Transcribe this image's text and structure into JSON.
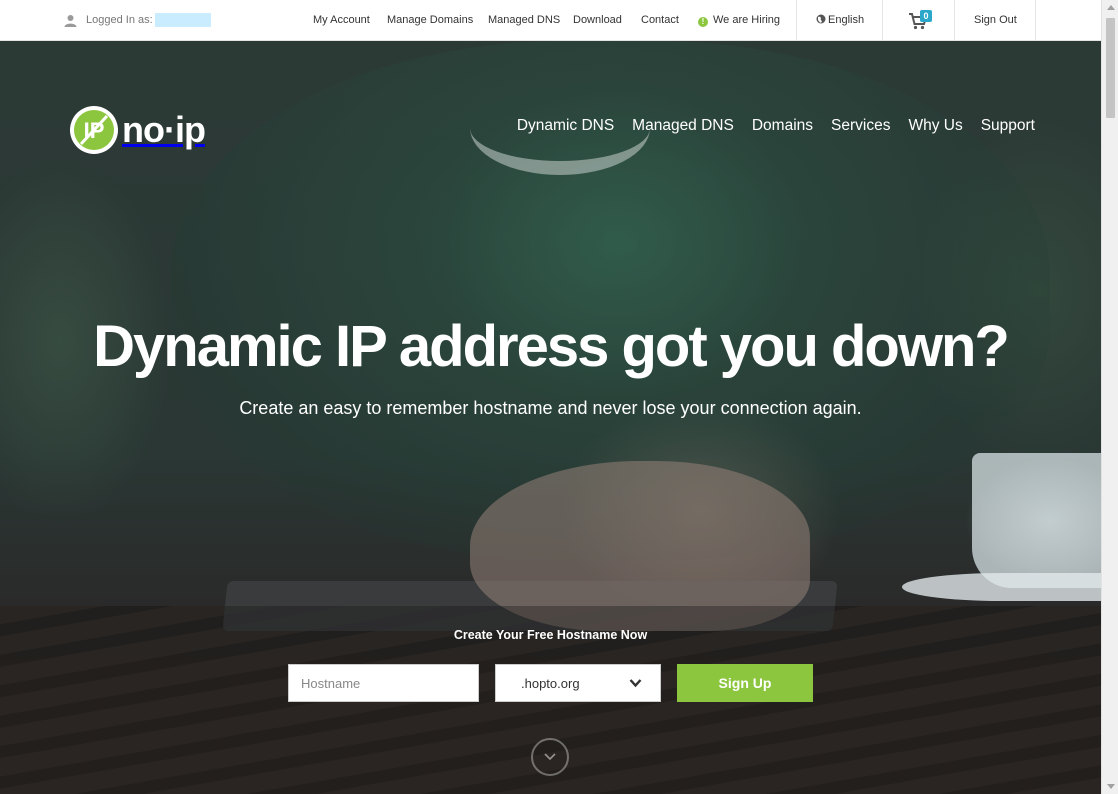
{
  "topbar": {
    "logged_in_label": "Logged In as:",
    "links": {
      "my_account": "My Account",
      "manage_domains": "Manage Domains",
      "managed_dns": "Managed DNS",
      "download": "Download",
      "contact": "Contact",
      "hiring": "We are Hiring",
      "language": "English",
      "sign_out": "Sign Out"
    },
    "cart_count": "0"
  },
  "brand": {
    "logo_text": "no·ip",
    "accent_color": "#8cc63f"
  },
  "main_nav": {
    "items": [
      "Dynamic DNS",
      "Managed DNS",
      "Domains",
      "Services",
      "Why Us",
      "Support"
    ]
  },
  "hero": {
    "headline": "Dynamic IP address got you down?",
    "subline": "Create an easy to remember hostname and never lose your connection again.",
    "form_label": "Create Your Free Hostname Now",
    "hostname_placeholder": "Hostname",
    "domain_selected": ".hopto.org",
    "signup_label": "Sign Up"
  }
}
